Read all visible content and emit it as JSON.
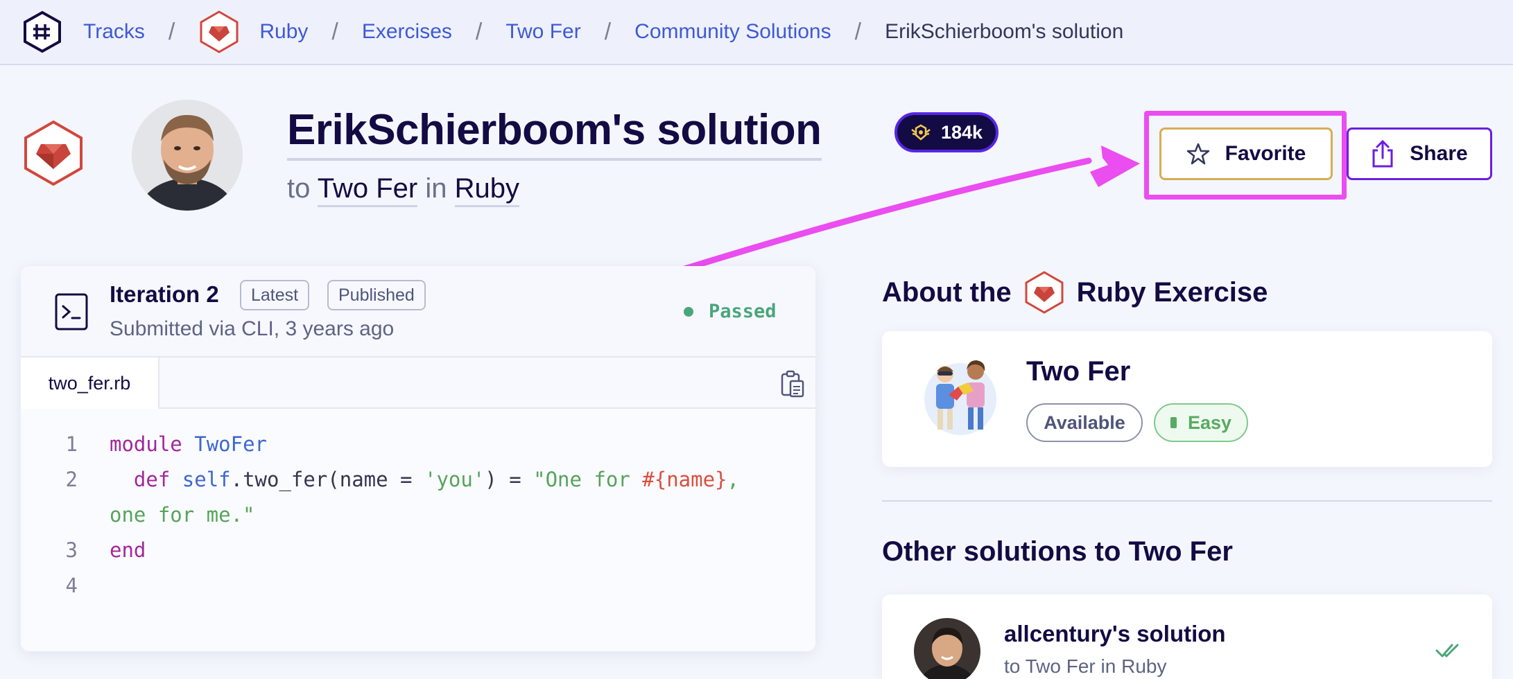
{
  "breadcrumb": {
    "tracks": "Tracks",
    "ruby": "Ruby",
    "exercises": "Exercises",
    "exercise": "Two Fer",
    "community": "Community Solutions",
    "current": "ErikSchierboom's solution",
    "separator": "/"
  },
  "header": {
    "title": "ErikSchierboom's solution",
    "to_word": "to",
    "exercise_link": "Two Fer",
    "in_word": "in",
    "track_link": "Ruby",
    "reputation": "184k",
    "favorite_label": "Favorite",
    "share_label": "Share"
  },
  "iteration": {
    "title": "Iteration 2",
    "latest_tag": "Latest",
    "published_tag": "Published",
    "submitted": "Submitted via CLI, 3 years ago",
    "status": "Passed",
    "file_tab": "two_fer.rb"
  },
  "code": {
    "line1_no": "1",
    "line1_kw": "module",
    "line1_const": "TwoFer",
    "line2_no": "2",
    "line2_def": "def",
    "line2_self": "self",
    "line2_plain": ".two_fer(name = ",
    "line2_str1": "'you'",
    "line2_plain2": ") = ",
    "line2_str2": "\"One for ",
    "line2_interp": "#{name}",
    "line2_str3": ",",
    "line2b_str": "one for me.\"",
    "line3_no": "3",
    "line3_kw": "end",
    "line4_no": "4"
  },
  "about": {
    "heading_pre": "About the",
    "heading_post": "Ruby Exercise",
    "exercise_name": "Two Fer",
    "available": "Available",
    "difficulty": "Easy"
  },
  "other": {
    "heading": "Other solutions to Two Fer",
    "solution_title": "allcentury's solution",
    "solution_sub": "to Two Fer in Ruby"
  },
  "colors": {
    "accent": "#3d59d8",
    "annotation": "#ea4df0",
    "passed": "#4aa67a",
    "easy": "#59aa63",
    "ruby": "#c9443a"
  }
}
